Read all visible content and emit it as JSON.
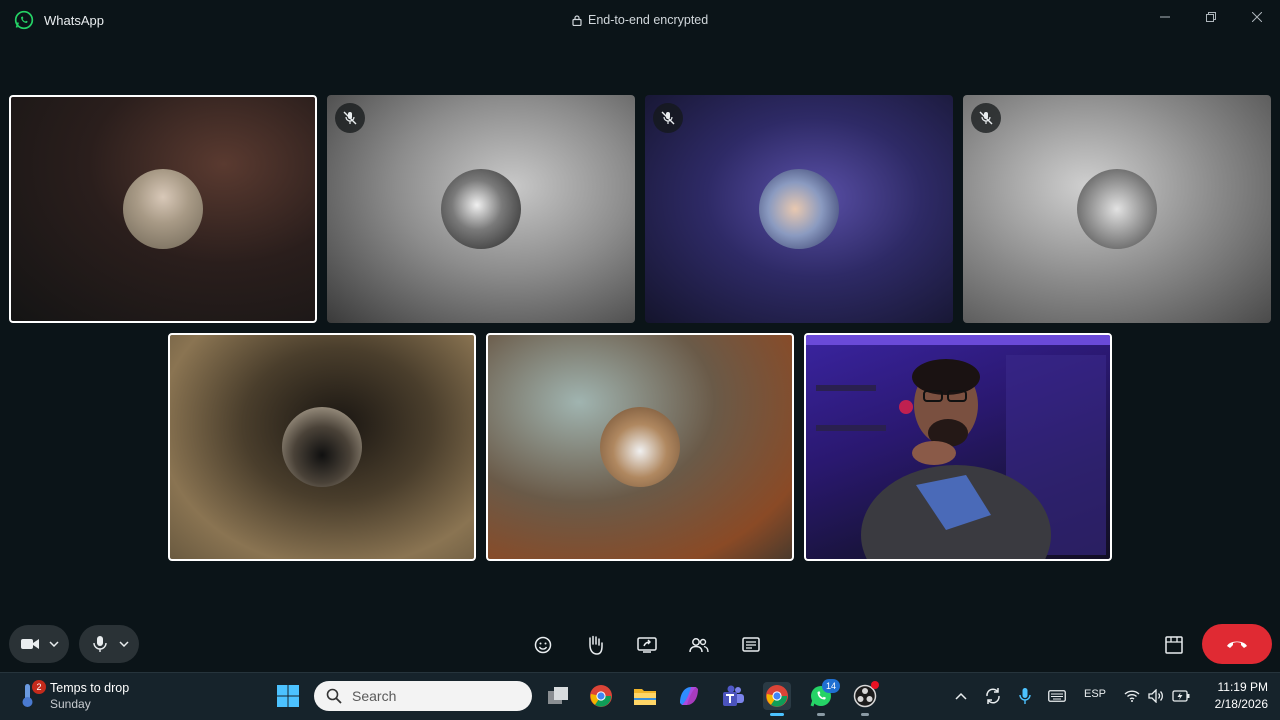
{
  "app": {
    "title": "WhatsApp",
    "encryption_label": "End-to-end encrypted"
  },
  "participants": [
    {
      "muted": false,
      "active": true
    },
    {
      "muted": true,
      "active": false
    },
    {
      "muted": true,
      "active": false
    },
    {
      "muted": true,
      "active": false
    },
    {
      "muted": false,
      "active": true
    },
    {
      "muted": false,
      "active": true
    },
    {
      "muted": false,
      "active": true,
      "video_on": true
    }
  ],
  "controls": {
    "camera_icon": "video-camera-icon",
    "mic_icon": "microphone-icon",
    "reactions_icon": "emoji-icon",
    "raise_hand_icon": "raise-hand-icon",
    "share_screen_icon": "share-screen-icon",
    "participants_icon": "participants-icon",
    "captions_icon": "captions-icon",
    "layout_icon": "layout-icon",
    "end_call_icon": "end-call-icon",
    "end_call_color": "#e02a33"
  },
  "taskbar": {
    "weather_badge": "2",
    "weather_title": "Temps to drop",
    "weather_subtitle": "Sunday",
    "search_placeholder": "Search",
    "whatsapp_badge": "14",
    "language": "ESP",
    "time": "11:19 PM",
    "date": "2/18/2026"
  }
}
